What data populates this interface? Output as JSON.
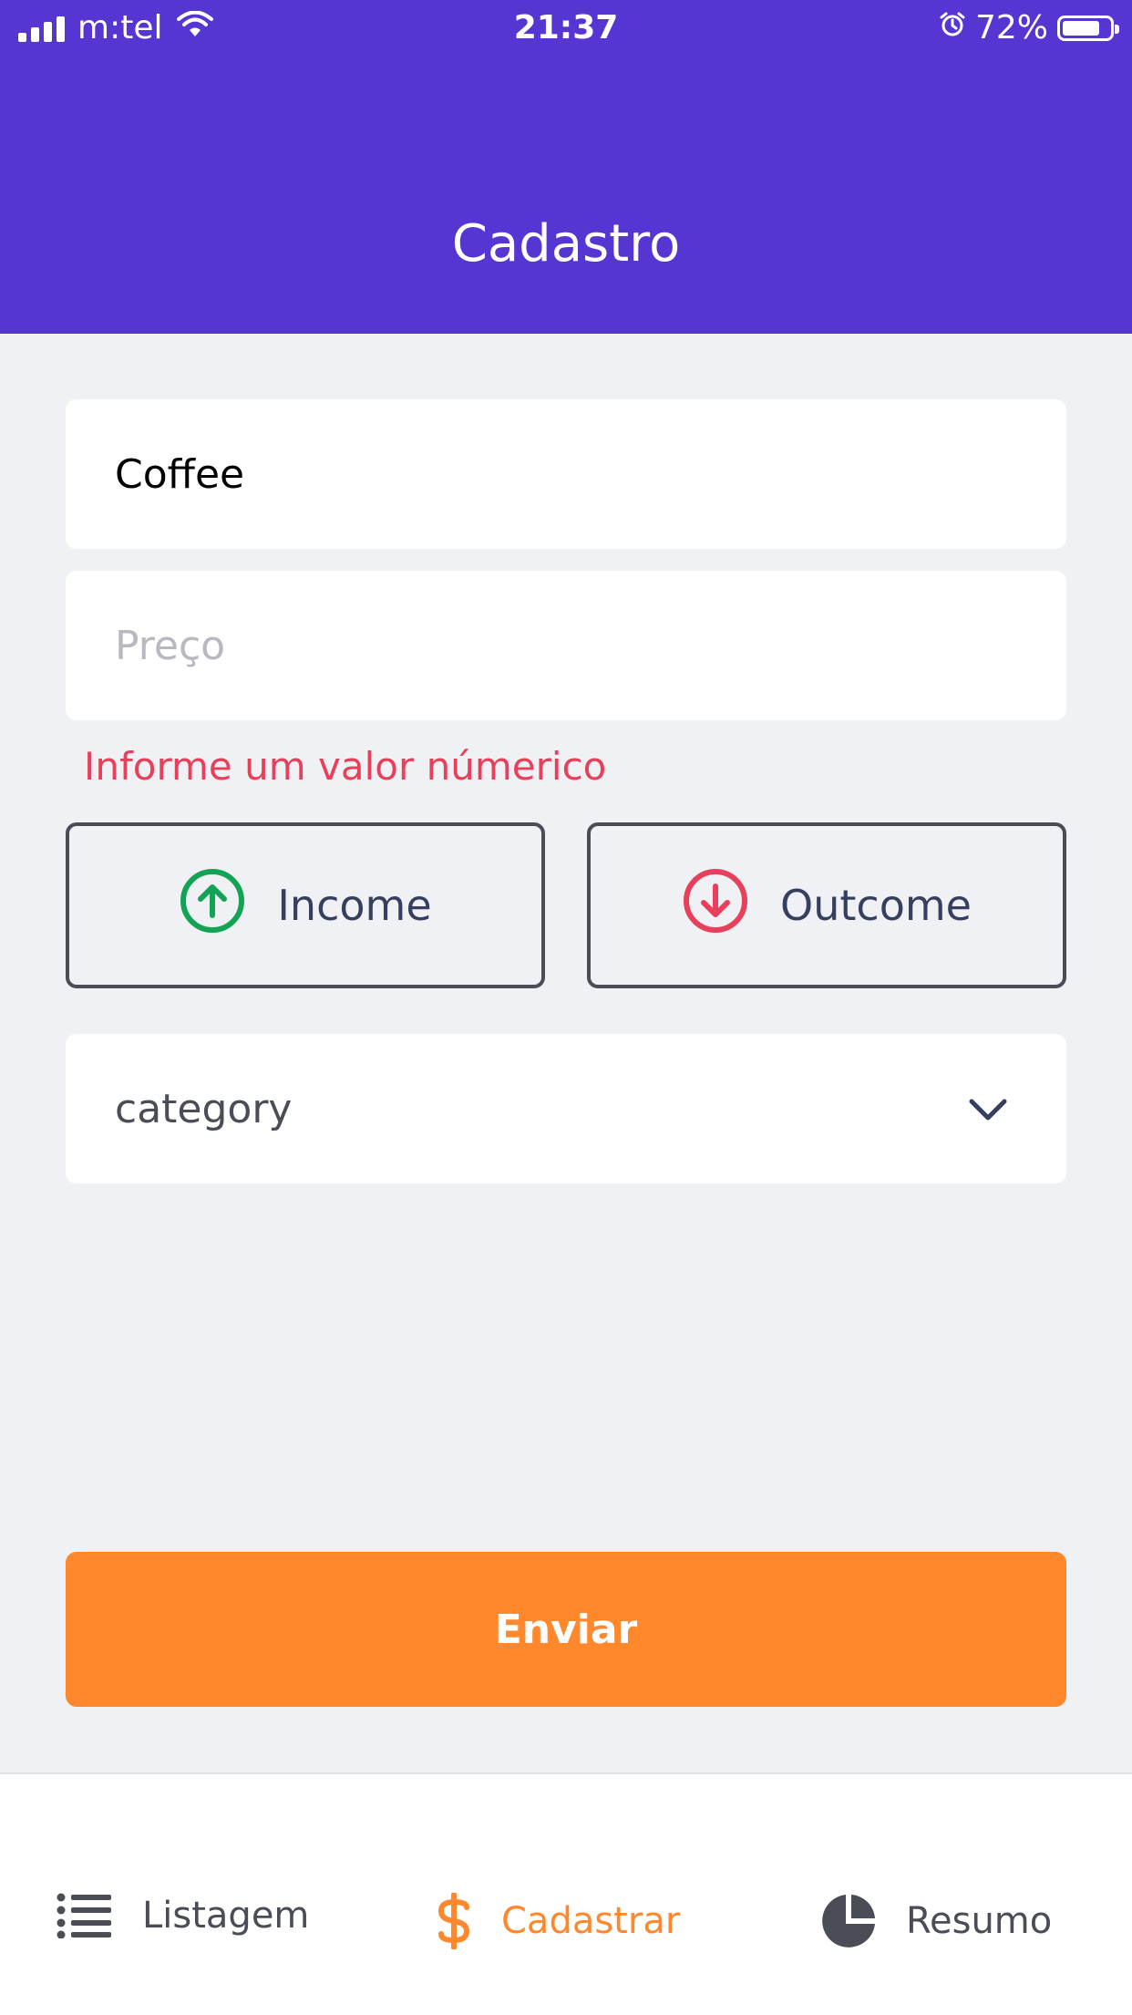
{
  "status_bar": {
    "carrier": "m:tel",
    "time": "21:37",
    "battery_percent": "72%"
  },
  "header": {
    "title": "Cadastro"
  },
  "form": {
    "name_value": "Coffee",
    "price_placeholder": "Preço",
    "price_error": "Informe um valor númerico",
    "type_income_label": "Income",
    "type_outcome_label": "Outcome",
    "category_placeholder": "category",
    "submit_label": "Enviar"
  },
  "tabs": [
    {
      "label": "Listagem",
      "icon": "list-icon",
      "active": false
    },
    {
      "label": "Cadastrar",
      "icon": "dollar-icon",
      "active": true
    },
    {
      "label": "Resumo",
      "icon": "pie-chart-icon",
      "active": false
    }
  ],
  "colors": {
    "primary": "#5636D3",
    "secondary": "#FF872C",
    "success": "#12A454",
    "attention": "#E83F5B",
    "background": "#F0F1F5"
  }
}
